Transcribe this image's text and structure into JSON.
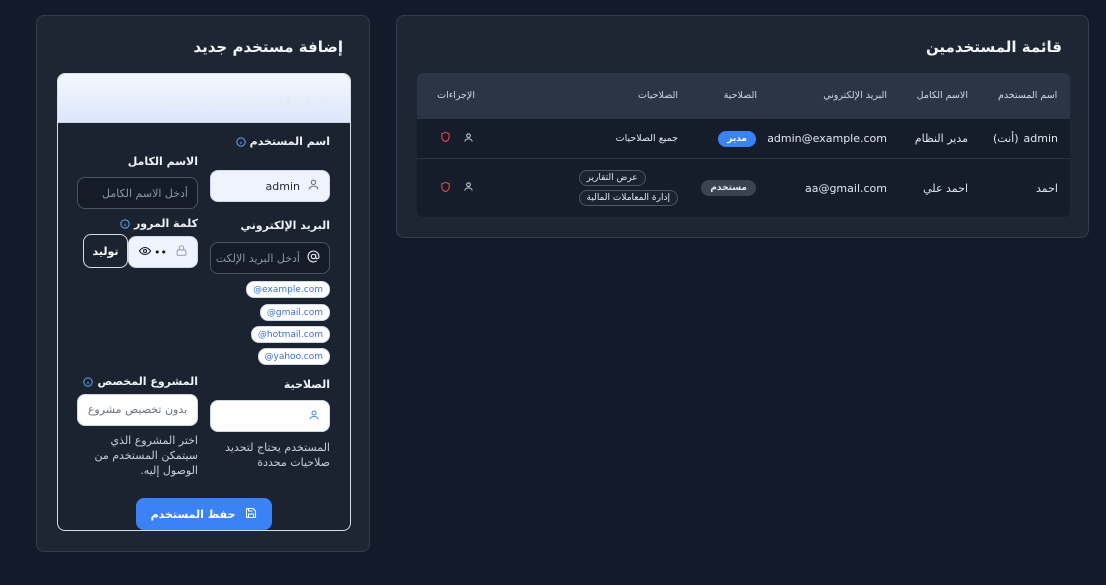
{
  "users_list": {
    "title": "قائمة المستخدمين",
    "columns": {
      "username": "اسم المستخدم",
      "full_name": "الاسم الكامل",
      "email": "البريد الإلكتروني",
      "role": "الصلاحية",
      "permissions": "الصلاحيات",
      "actions": "الإجراءات"
    },
    "rows": [
      {
        "username": "admin",
        "you_tag": "(أنت)",
        "full_name": "مدير النظام",
        "email": "admin@example.com",
        "role": "مدير",
        "permissions": [
          "جميع الصلاحيات"
        ]
      },
      {
        "username": "احمد",
        "full_name": "احمد علي",
        "email": "aa@gmail.com",
        "role": "مستخدم",
        "permissions": [
          "عرض التقارير",
          "إدارة المعاملات المالية"
        ]
      }
    ]
  },
  "add_user": {
    "title": "إضافة مستخدم جديد",
    "header_title": "إضافة مستخدم جديد",
    "username_label": "اسم المستخدم",
    "username_value": "admin",
    "full_name_label": "الاسم الكامل",
    "full_name_placeholder": "أدخل الاسم الكامل",
    "email_label": "البريد الإلكتروني",
    "email_placeholder": "أدخل البريد الإلكت",
    "email_domains": [
      "@example.com",
      "@gmail.com",
      "@hotmail.com",
      "@yahoo.com"
    ],
    "password_label": "كلمة المرور",
    "password_value": "••",
    "generate_label": "توليد",
    "role_label": "الصلاحية",
    "role_helper": "المستخدم يحتاج لتحديد صلاحيات محددة",
    "project_label": "المشروع المخصص",
    "project_placeholder": "بدون تخصيص مشروع",
    "project_helper": "اختر المشروع الذي سيتمكن المستخدم من الوصول إليه.",
    "save_label": "حفظ المستخدم"
  },
  "colors": {
    "background": "#131a2a",
    "panel": "#1e2633",
    "accent": "#3b82f6",
    "danger": "#ef4444"
  }
}
